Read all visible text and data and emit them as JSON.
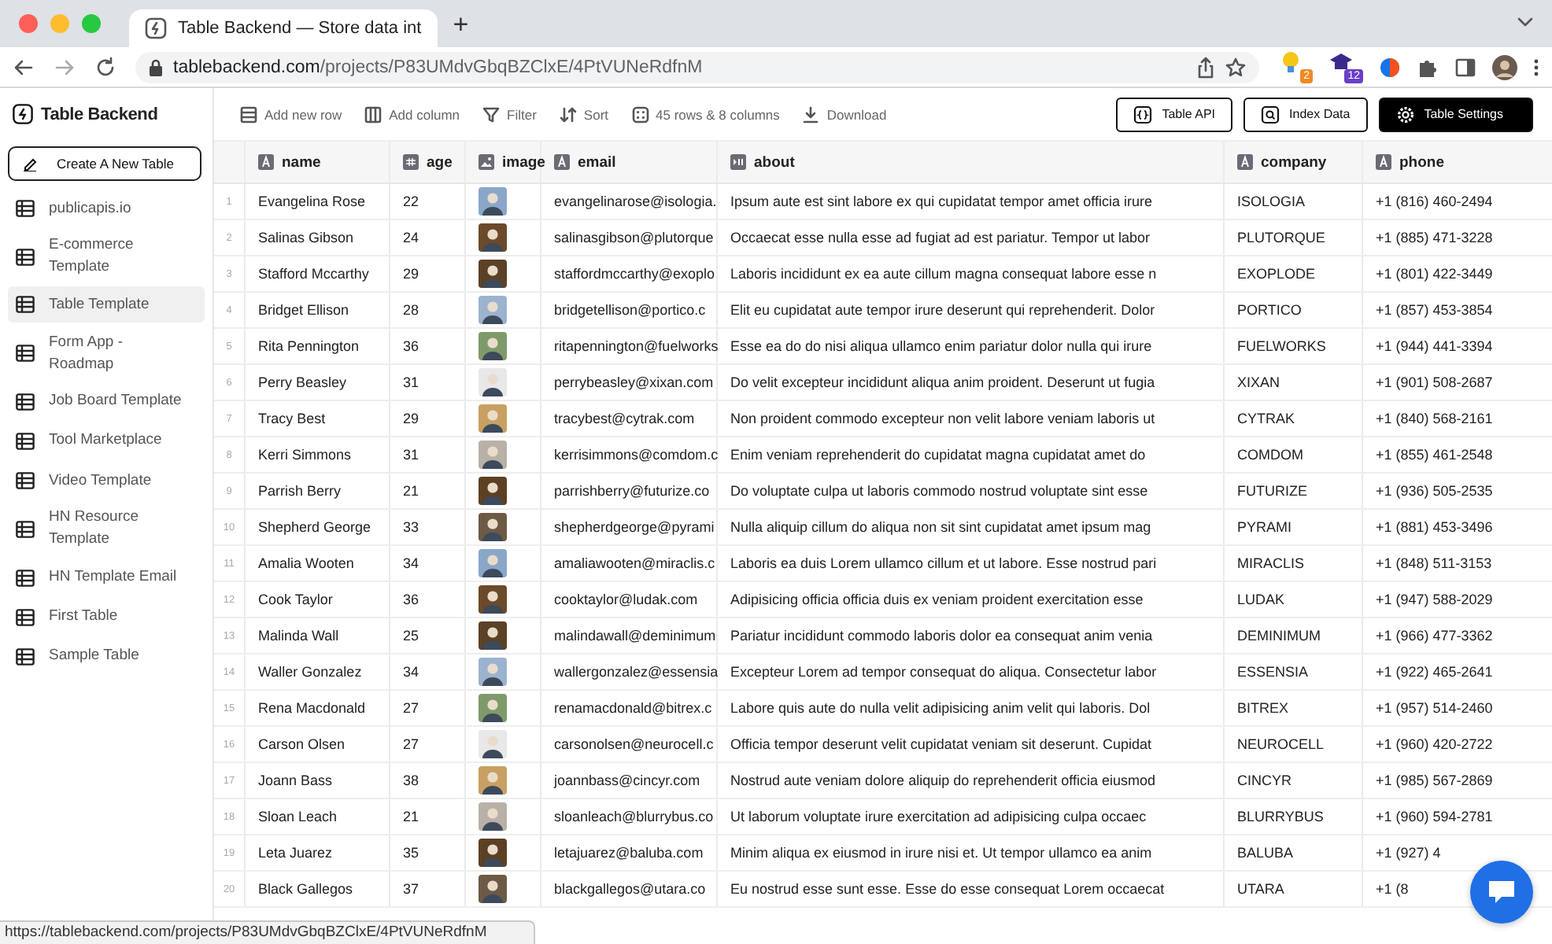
{
  "browser": {
    "tab": {
      "title": "Table Backend — Store data int"
    },
    "new_tab": "+",
    "url": {
      "host": "tablebackend.com",
      "path": "/projects/P83UMdvGbqBZClxE/4PtVUNeRdfnM"
    },
    "extensions": [
      {
        "kind": "bulb",
        "badge": "2",
        "color": "#f08a24"
      },
      {
        "kind": "cap",
        "badge": "12",
        "color": "#6a3fc7"
      }
    ]
  },
  "app": {
    "logo": "Table Backend",
    "create_button": "Create A New Table",
    "sidebar": {
      "items": [
        {
          "label": "publicapis.io",
          "selected": false
        },
        {
          "label": "E-commerce Template",
          "selected": false
        },
        {
          "label": "Table Template",
          "selected": true
        },
        {
          "label": "Form App - Roadmap",
          "selected": false
        },
        {
          "label": "Job Board Template",
          "selected": false
        },
        {
          "label": "Tool Marketplace",
          "selected": false
        },
        {
          "label": "Video Template",
          "selected": false
        },
        {
          "label": "HN Resource Template",
          "selected": false
        },
        {
          "label": "HN Template Email",
          "selected": false
        },
        {
          "label": "First Table",
          "selected": false
        },
        {
          "label": "Sample Table",
          "selected": false
        }
      ]
    },
    "toolbar": {
      "actions": [
        {
          "kind": "add-row",
          "label": "Add new row"
        },
        {
          "kind": "add-column",
          "label": "Add column"
        },
        {
          "kind": "filter",
          "label": "Filter"
        },
        {
          "kind": "sort",
          "label": "Sort"
        },
        {
          "kind": "count",
          "label": "45 rows & 8 columns"
        },
        {
          "kind": "download",
          "label": "Download"
        }
      ],
      "buttons": [
        {
          "kind": "api",
          "label": "Table API",
          "primary": false
        },
        {
          "kind": "index",
          "label": "Index Data",
          "primary": false
        },
        {
          "kind": "settings",
          "label": "Table Settings",
          "primary": true
        }
      ]
    },
    "table": {
      "columns": [
        {
          "name": "name",
          "kind": "text"
        },
        {
          "name": "age",
          "kind": "number"
        },
        {
          "name": "image",
          "kind": "image"
        },
        {
          "name": "email",
          "kind": "text"
        },
        {
          "name": "about",
          "kind": "rich"
        },
        {
          "name": "company",
          "kind": "text"
        },
        {
          "name": "phone",
          "kind": "text"
        }
      ],
      "rows": [
        {
          "number": "1",
          "name": "Evangelina Rose",
          "age": "22",
          "email": "evangelinarose@isologia.",
          "about": "Ipsum aute est sint labore ex qui cupidatat tempor amet officia irure",
          "company": "ISOLOGIA",
          "phone": "+1 (816) 460-2494"
        },
        {
          "number": "2",
          "name": "Salinas Gibson",
          "age": "24",
          "email": "salinasgibson@plutorque",
          "about": "Occaecat esse nulla esse ad fugiat ad est pariatur. Tempor ut labor",
          "company": "PLUTORQUE",
          "phone": "+1 (885) 471-3228"
        },
        {
          "number": "3",
          "name": "Stafford Mccarthy",
          "age": "29",
          "email": "staffordmccarthy@exoplo",
          "about": "Laboris incididunt ex ea aute cillum magna consequat labore esse n",
          "company": "EXOPLODE",
          "phone": "+1 (801) 422-3449"
        },
        {
          "number": "4",
          "name": "Bridget Ellison",
          "age": "28",
          "email": "bridgetellison@portico.c",
          "about": "Elit eu cupidatat aute tempor irure deserunt qui reprehenderit. Dolor",
          "company": "PORTICO",
          "phone": "+1 (857) 453-3854"
        },
        {
          "number": "5",
          "name": "Rita Pennington",
          "age": "36",
          "email": "ritapennington@fuelworks",
          "about": "Esse ea do do nisi aliqua ullamco enim pariatur dolor nulla qui irure",
          "company": "FUELWORKS",
          "phone": "+1 (944) 441-3394"
        },
        {
          "number": "6",
          "name": "Perry Beasley",
          "age": "31",
          "email": "perrybeasley@xixan.com",
          "about": "Do velit excepteur incididunt aliqua anim proident. Deserunt ut fugia",
          "company": "XIXAN",
          "phone": "+1 (901) 508-2687"
        },
        {
          "number": "7",
          "name": "Tracy Best",
          "age": "29",
          "email": "tracybest@cytrak.com",
          "about": "Non proident commodo excepteur non velit labore veniam laboris ut",
          "company": "CYTRAK",
          "phone": "+1 (840) 568-2161"
        },
        {
          "number": "8",
          "name": "Kerri Simmons",
          "age": "31",
          "email": "kerrisimmons@comdom.c",
          "about": "Enim veniam reprehenderit do cupidatat magna cupidatat amet do",
          "company": "COMDOM",
          "phone": "+1 (855) 461-2548"
        },
        {
          "number": "9",
          "name": "Parrish Berry",
          "age": "21",
          "email": "parrishberry@futurize.co",
          "about": "Do voluptate culpa ut laboris commodo nostrud voluptate sint esse",
          "company": "FUTURIZE",
          "phone": "+1 (936) 505-2535"
        },
        {
          "number": "10",
          "name": "Shepherd George",
          "age": "33",
          "email": "shepherdgeorge@pyrami",
          "about": "Nulla aliquip cillum do aliqua non sit sint cupidatat amet ipsum mag",
          "company": "PYRAMI",
          "phone": "+1 (881) 453-3496"
        },
        {
          "number": "11",
          "name": "Amalia Wooten",
          "age": "34",
          "email": "amaliawooten@miraclis.c",
          "about": "Laboris ea duis Lorem ullamco cillum et ut labore. Esse nostrud pari",
          "company": "MIRACLIS",
          "phone": "+1 (848) 511-3153"
        },
        {
          "number": "12",
          "name": "Cook Taylor",
          "age": "36",
          "email": "cooktaylor@ludak.com",
          "about": "Adipisicing officia officia duis ex veniam proident exercitation esse",
          "company": "LUDAK",
          "phone": "+1 (947) 588-2029"
        },
        {
          "number": "13",
          "name": "Malinda Wall",
          "age": "25",
          "email": "malindawall@deminimum",
          "about": "Pariatur incididunt commodo laboris dolor ea consequat anim venia",
          "company": "DEMINIMUM",
          "phone": "+1 (966) 477-3362"
        },
        {
          "number": "14",
          "name": "Waller Gonzalez",
          "age": "34",
          "email": "wallergonzalez@essensia",
          "about": "Excepteur Lorem ad tempor consequat do aliqua. Consectetur labor",
          "company": "ESSENSIA",
          "phone": "+1 (922) 465-2641"
        },
        {
          "number": "15",
          "name": "Rena Macdonald",
          "age": "27",
          "email": "renamacdonald@bitrex.c",
          "about": "Labore quis aute do nulla velit adipisicing anim velit qui laboris. Dol",
          "company": "BITREX",
          "phone": "+1 (957) 514-2460"
        },
        {
          "number": "16",
          "name": "Carson Olsen",
          "age": "27",
          "email": "carsonolsen@neurocell.c",
          "about": "Officia tempor deserunt velit cupidatat veniam sit deserunt. Cupidat",
          "company": "NEUROCELL",
          "phone": "+1 (960) 420-2722"
        },
        {
          "number": "17",
          "name": "Joann Bass",
          "age": "38",
          "email": "joannbass@cincyr.com",
          "about": "Nostrud aute veniam dolore aliquip do reprehenderit officia eiusmod",
          "company": "CINCYR",
          "phone": "+1 (985) 567-2869"
        },
        {
          "number": "18",
          "name": "Sloan Leach",
          "age": "21",
          "email": "sloanleach@blurrybus.co",
          "about": "Ut laborum voluptate irure exercitation ad adipisicing culpa occaec",
          "company": "BLURRYBUS",
          "phone": "+1 (960) 594-2781"
        },
        {
          "number": "19",
          "name": "Leta Juarez",
          "age": "35",
          "email": "letajuarez@baluba.com",
          "about": "Minim aliqua ex eiusmod in irure nisi et. Ut tempor ullamco ea anim",
          "company": "BALUBA",
          "phone": "+1 (927) 4"
        },
        {
          "number": "20",
          "name": "Black Gallegos",
          "age": "37",
          "email": "blackgallegos@utara.co",
          "about": "Eu nostrud esse sunt esse. Esse do esse consequat Lorem occaecat",
          "company": "UTARA",
          "phone": "+1 (8"
        }
      ]
    }
  },
  "status_url": "https://tablebackend.com/projects/P83UMdvGbqBZClxE/4PtVUNeRdfnM"
}
